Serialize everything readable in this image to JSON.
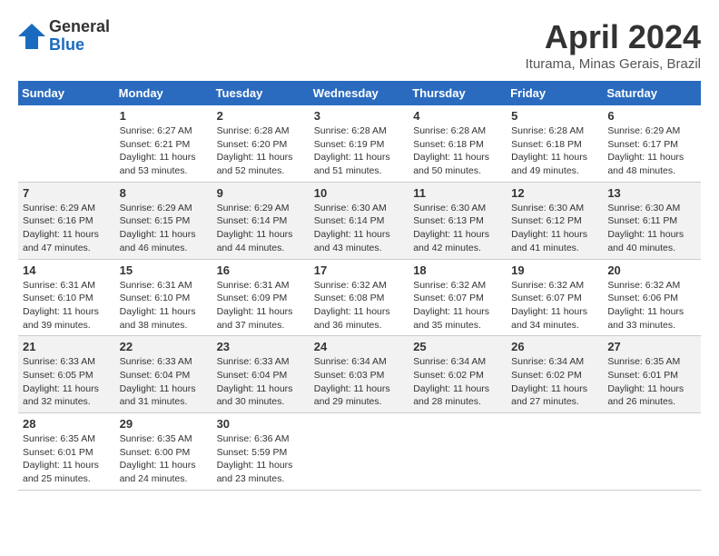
{
  "header": {
    "logo_general": "General",
    "logo_blue": "Blue",
    "month_title": "April 2024",
    "location": "Iturama, Minas Gerais, Brazil"
  },
  "weekdays": [
    "Sunday",
    "Monday",
    "Tuesday",
    "Wednesday",
    "Thursday",
    "Friday",
    "Saturday"
  ],
  "weeks": [
    [
      {
        "day": "",
        "sunrise": "",
        "sunset": "",
        "daylight": ""
      },
      {
        "day": "1",
        "sunrise": "Sunrise: 6:27 AM",
        "sunset": "Sunset: 6:21 PM",
        "daylight": "Daylight: 11 hours and 53 minutes."
      },
      {
        "day": "2",
        "sunrise": "Sunrise: 6:28 AM",
        "sunset": "Sunset: 6:20 PM",
        "daylight": "Daylight: 11 hours and 52 minutes."
      },
      {
        "day": "3",
        "sunrise": "Sunrise: 6:28 AM",
        "sunset": "Sunset: 6:19 PM",
        "daylight": "Daylight: 11 hours and 51 minutes."
      },
      {
        "day": "4",
        "sunrise": "Sunrise: 6:28 AM",
        "sunset": "Sunset: 6:18 PM",
        "daylight": "Daylight: 11 hours and 50 minutes."
      },
      {
        "day": "5",
        "sunrise": "Sunrise: 6:28 AM",
        "sunset": "Sunset: 6:18 PM",
        "daylight": "Daylight: 11 hours and 49 minutes."
      },
      {
        "day": "6",
        "sunrise": "Sunrise: 6:29 AM",
        "sunset": "Sunset: 6:17 PM",
        "daylight": "Daylight: 11 hours and 48 minutes."
      }
    ],
    [
      {
        "day": "7",
        "sunrise": "Sunrise: 6:29 AM",
        "sunset": "Sunset: 6:16 PM",
        "daylight": "Daylight: 11 hours and 47 minutes."
      },
      {
        "day": "8",
        "sunrise": "Sunrise: 6:29 AM",
        "sunset": "Sunset: 6:15 PM",
        "daylight": "Daylight: 11 hours and 46 minutes."
      },
      {
        "day": "9",
        "sunrise": "Sunrise: 6:29 AM",
        "sunset": "Sunset: 6:14 PM",
        "daylight": "Daylight: 11 hours and 44 minutes."
      },
      {
        "day": "10",
        "sunrise": "Sunrise: 6:30 AM",
        "sunset": "Sunset: 6:14 PM",
        "daylight": "Daylight: 11 hours and 43 minutes."
      },
      {
        "day": "11",
        "sunrise": "Sunrise: 6:30 AM",
        "sunset": "Sunset: 6:13 PM",
        "daylight": "Daylight: 11 hours and 42 minutes."
      },
      {
        "day": "12",
        "sunrise": "Sunrise: 6:30 AM",
        "sunset": "Sunset: 6:12 PM",
        "daylight": "Daylight: 11 hours and 41 minutes."
      },
      {
        "day": "13",
        "sunrise": "Sunrise: 6:30 AM",
        "sunset": "Sunset: 6:11 PM",
        "daylight": "Daylight: 11 hours and 40 minutes."
      }
    ],
    [
      {
        "day": "14",
        "sunrise": "Sunrise: 6:31 AM",
        "sunset": "Sunset: 6:10 PM",
        "daylight": "Daylight: 11 hours and 39 minutes."
      },
      {
        "day": "15",
        "sunrise": "Sunrise: 6:31 AM",
        "sunset": "Sunset: 6:10 PM",
        "daylight": "Daylight: 11 hours and 38 minutes."
      },
      {
        "day": "16",
        "sunrise": "Sunrise: 6:31 AM",
        "sunset": "Sunset: 6:09 PM",
        "daylight": "Daylight: 11 hours and 37 minutes."
      },
      {
        "day": "17",
        "sunrise": "Sunrise: 6:32 AM",
        "sunset": "Sunset: 6:08 PM",
        "daylight": "Daylight: 11 hours and 36 minutes."
      },
      {
        "day": "18",
        "sunrise": "Sunrise: 6:32 AM",
        "sunset": "Sunset: 6:07 PM",
        "daylight": "Daylight: 11 hours and 35 minutes."
      },
      {
        "day": "19",
        "sunrise": "Sunrise: 6:32 AM",
        "sunset": "Sunset: 6:07 PM",
        "daylight": "Daylight: 11 hours and 34 minutes."
      },
      {
        "day": "20",
        "sunrise": "Sunrise: 6:32 AM",
        "sunset": "Sunset: 6:06 PM",
        "daylight": "Daylight: 11 hours and 33 minutes."
      }
    ],
    [
      {
        "day": "21",
        "sunrise": "Sunrise: 6:33 AM",
        "sunset": "Sunset: 6:05 PM",
        "daylight": "Daylight: 11 hours and 32 minutes."
      },
      {
        "day": "22",
        "sunrise": "Sunrise: 6:33 AM",
        "sunset": "Sunset: 6:04 PM",
        "daylight": "Daylight: 11 hours and 31 minutes."
      },
      {
        "day": "23",
        "sunrise": "Sunrise: 6:33 AM",
        "sunset": "Sunset: 6:04 PM",
        "daylight": "Daylight: 11 hours and 30 minutes."
      },
      {
        "day": "24",
        "sunrise": "Sunrise: 6:34 AM",
        "sunset": "Sunset: 6:03 PM",
        "daylight": "Daylight: 11 hours and 29 minutes."
      },
      {
        "day": "25",
        "sunrise": "Sunrise: 6:34 AM",
        "sunset": "Sunset: 6:02 PM",
        "daylight": "Daylight: 11 hours and 28 minutes."
      },
      {
        "day": "26",
        "sunrise": "Sunrise: 6:34 AM",
        "sunset": "Sunset: 6:02 PM",
        "daylight": "Daylight: 11 hours and 27 minutes."
      },
      {
        "day": "27",
        "sunrise": "Sunrise: 6:35 AM",
        "sunset": "Sunset: 6:01 PM",
        "daylight": "Daylight: 11 hours and 26 minutes."
      }
    ],
    [
      {
        "day": "28",
        "sunrise": "Sunrise: 6:35 AM",
        "sunset": "Sunset: 6:01 PM",
        "daylight": "Daylight: 11 hours and 25 minutes."
      },
      {
        "day": "29",
        "sunrise": "Sunrise: 6:35 AM",
        "sunset": "Sunset: 6:00 PM",
        "daylight": "Daylight: 11 hours and 24 minutes."
      },
      {
        "day": "30",
        "sunrise": "Sunrise: 6:36 AM",
        "sunset": "Sunset: 5:59 PM",
        "daylight": "Daylight: 11 hours and 23 minutes."
      },
      {
        "day": "",
        "sunrise": "",
        "sunset": "",
        "daylight": ""
      },
      {
        "day": "",
        "sunrise": "",
        "sunset": "",
        "daylight": ""
      },
      {
        "day": "",
        "sunrise": "",
        "sunset": "",
        "daylight": ""
      },
      {
        "day": "",
        "sunrise": "",
        "sunset": "",
        "daylight": ""
      }
    ]
  ]
}
